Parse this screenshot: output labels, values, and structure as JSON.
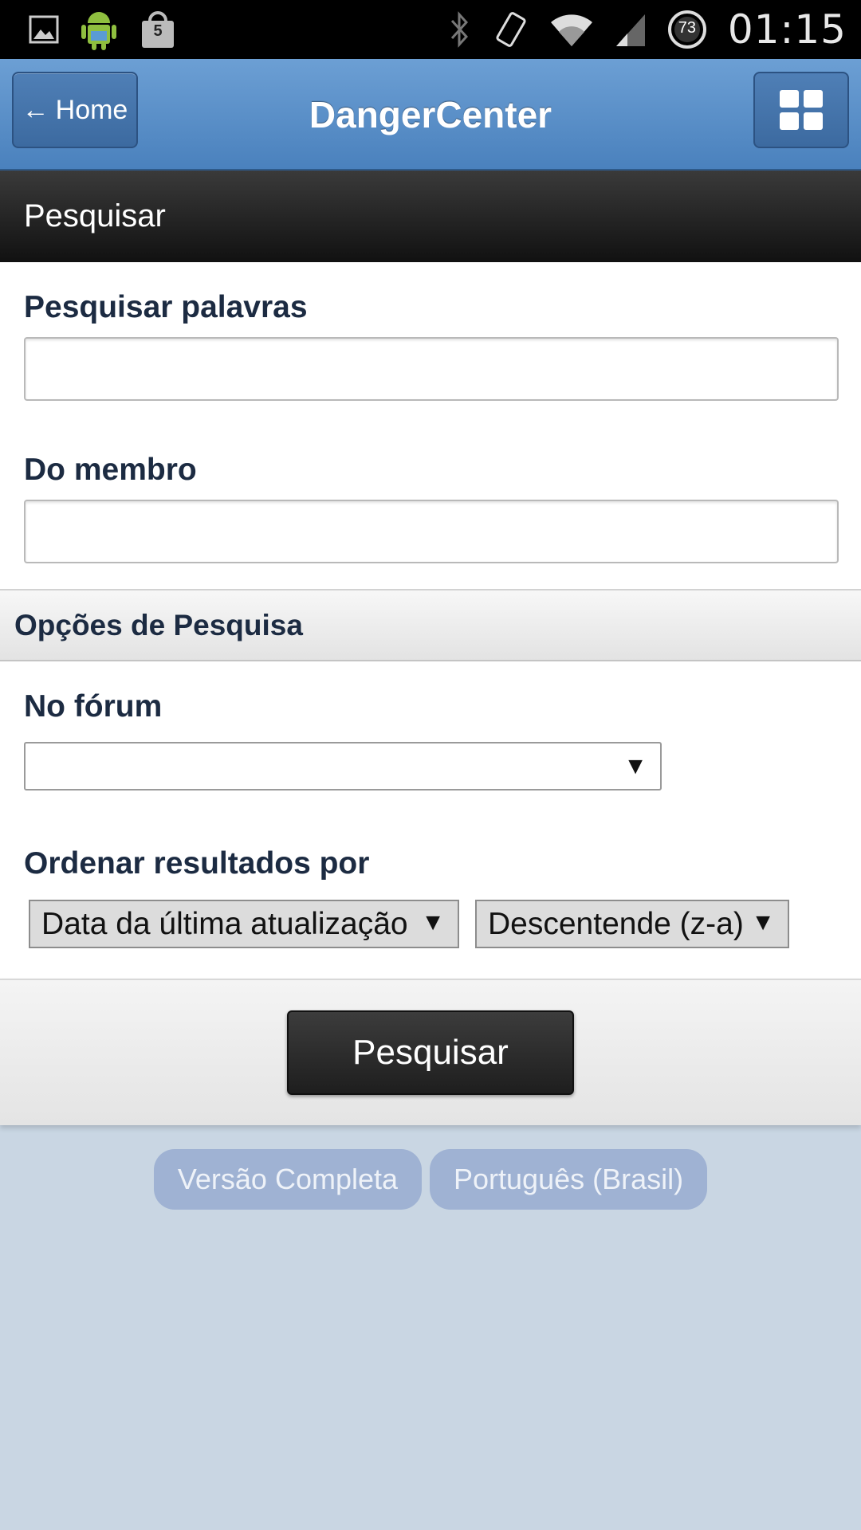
{
  "status_bar": {
    "time": "01:15",
    "battery_level": "73",
    "notification_badge": "5",
    "icons_left": [
      "image-icon",
      "android-icon",
      "shopping-bag-icon"
    ],
    "icons_right": [
      "bluetooth-icon",
      "vibrate-icon",
      "wifi-icon",
      "signal-icon",
      "battery-icon"
    ]
  },
  "header": {
    "home_label": "Home",
    "title": "DangerCenter"
  },
  "section": {
    "title": "Pesquisar"
  },
  "form": {
    "keywords_label": "Pesquisar palavras",
    "keywords_value": "",
    "member_label": "Do membro",
    "member_value": ""
  },
  "options": {
    "header": "Opções de Pesquisa",
    "forum_label": "No fórum",
    "forum_value": "",
    "order_label": "Ordenar resultados por",
    "order_field_value": "Data da última atualização",
    "order_direction_value": "Descentende (z-a)"
  },
  "actions": {
    "search_button": "Pesquisar"
  },
  "footer": {
    "full_version": "Versão Completa",
    "language": "Português (Brasil)"
  },
  "colors": {
    "header_blue": "#5a8fc9",
    "page_bg": "#c9d6e3",
    "label_text": "#1c2b42"
  }
}
